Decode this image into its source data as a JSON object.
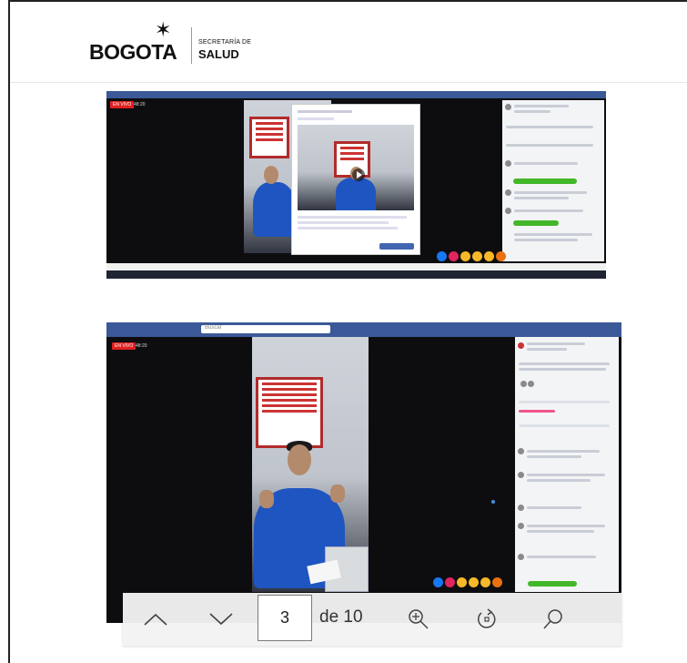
{
  "logo": {
    "word": "BOGOTA",
    "secretaria": "SECRETARÍA DE",
    "salud": "SALUD"
  },
  "screenshots": [
    {
      "live_badge": "EN VIVO",
      "live_time": "48:20",
      "emoji_colors": [
        "#1877f2",
        "#e0245e",
        "#f7b928",
        "#f7b928",
        "#f7b928",
        "#e9710f"
      ]
    },
    {
      "live_badge": "EN VIVO",
      "live_time": "48:20",
      "search_placeholder": "Buscar",
      "emoji_colors": [
        "#1877f2",
        "#e0245e",
        "#f7b928",
        "#f7b928",
        "#f7b928",
        "#e9710f"
      ]
    }
  ],
  "toolbar": {
    "current_page": "3",
    "total_pages": "de 10",
    "buttons": [
      "chevron-up-icon",
      "chevron-down-icon",
      "zoom-in-icon",
      "rotate-icon",
      "search-icon"
    ]
  },
  "colors": {
    "facebook_blue": "#3b5998",
    "jacket_blue": "#1f55c0",
    "comment_green": "#42b72a",
    "toolbar_bg": "#f2f2f2"
  }
}
